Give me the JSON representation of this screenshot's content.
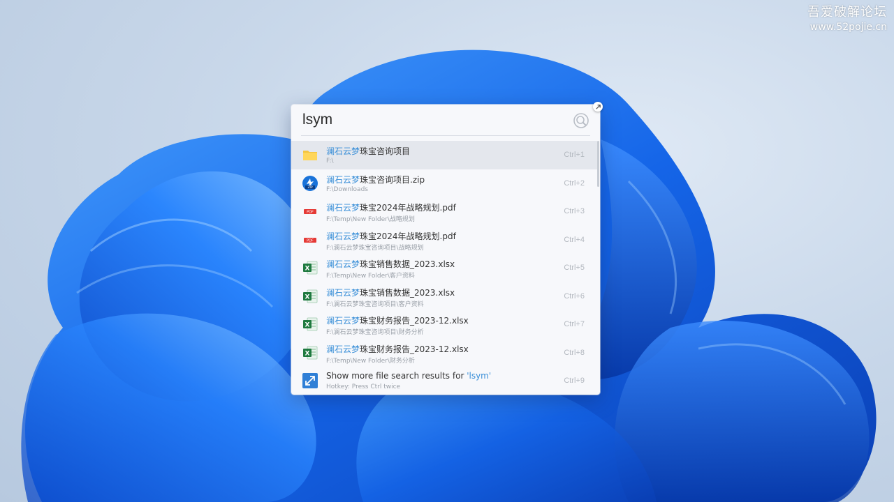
{
  "watermark": {
    "title": "吾爱破解论坛",
    "url": "www.52pojie.cn"
  },
  "search": {
    "query": "lsym",
    "icon": "search-icon"
  },
  "accent_color": "#3a8fd8",
  "results": [
    {
      "highlight": "澜石云梦",
      "rest": "珠宝咨询项目",
      "path": "F:\\",
      "hotkey": "Ctrl+1",
      "icon": "folder-icon",
      "selected": true
    },
    {
      "highlight": "澜石云梦",
      "rest": "珠宝咨询项目.zip",
      "path": "F:\\Downloads",
      "hotkey": "Ctrl+2",
      "icon": "zip-icon"
    },
    {
      "highlight": "澜石云梦",
      "rest": "珠宝2024年战略规划.pdf",
      "path": "F:\\Temp\\New Folder\\战略规划",
      "hotkey": "Ctrl+3",
      "icon": "pdf-icon"
    },
    {
      "highlight": "澜石云梦",
      "rest": "珠宝2024年战略规划.pdf",
      "path": "F:\\澜石云梦珠宝咨询项目\\战略规划",
      "hotkey": "Ctrl+4",
      "icon": "pdf-icon"
    },
    {
      "highlight": "澜石云梦",
      "rest": "珠宝销售数据_2023.xlsx",
      "path": "F:\\Temp\\New Folder\\客户资料",
      "hotkey": "Ctrl+5",
      "icon": "excel-icon"
    },
    {
      "highlight": "澜石云梦",
      "rest": "珠宝销售数据_2023.xlsx",
      "path": "F:\\澜石云梦珠宝咨询项目\\客户资料",
      "hotkey": "Ctrl+6",
      "icon": "excel-icon"
    },
    {
      "highlight": "澜石云梦",
      "rest": "珠宝财务报告_2023-12.xlsx",
      "path": "F:\\澜石云梦珠宝咨询项目\\财务分析",
      "hotkey": "Ctrl+7",
      "icon": "excel-icon"
    },
    {
      "highlight": "澜石云梦",
      "rest": "珠宝财务报告_2023-12.xlsx",
      "path": "F:\\Temp\\New Folder\\财务分析",
      "hotkey": "Ctrl+8",
      "icon": "excel-icon"
    }
  ],
  "more": {
    "prefix": "Show more file search results for ",
    "query_quoted": "'lsym'",
    "hint": "Hotkey: Press Ctrl twice",
    "hotkey": "Ctrl+9",
    "icon": "expand-icon"
  }
}
